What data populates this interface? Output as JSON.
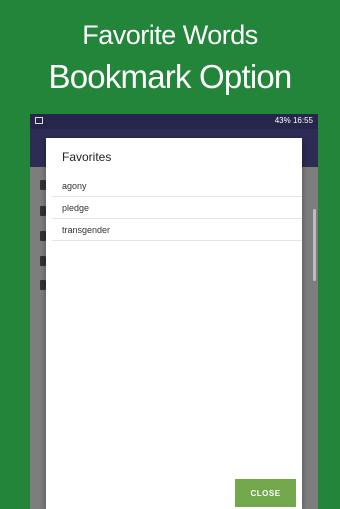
{
  "promo": {
    "line1": "Favorite Words",
    "line2": "Bookmark Option"
  },
  "statusbar": {
    "right_text": "43% 16:55"
  },
  "dialog": {
    "title": "Favorites",
    "items": [
      "agony",
      "pledge",
      "transgender"
    ],
    "close_label": "CLOSE"
  }
}
